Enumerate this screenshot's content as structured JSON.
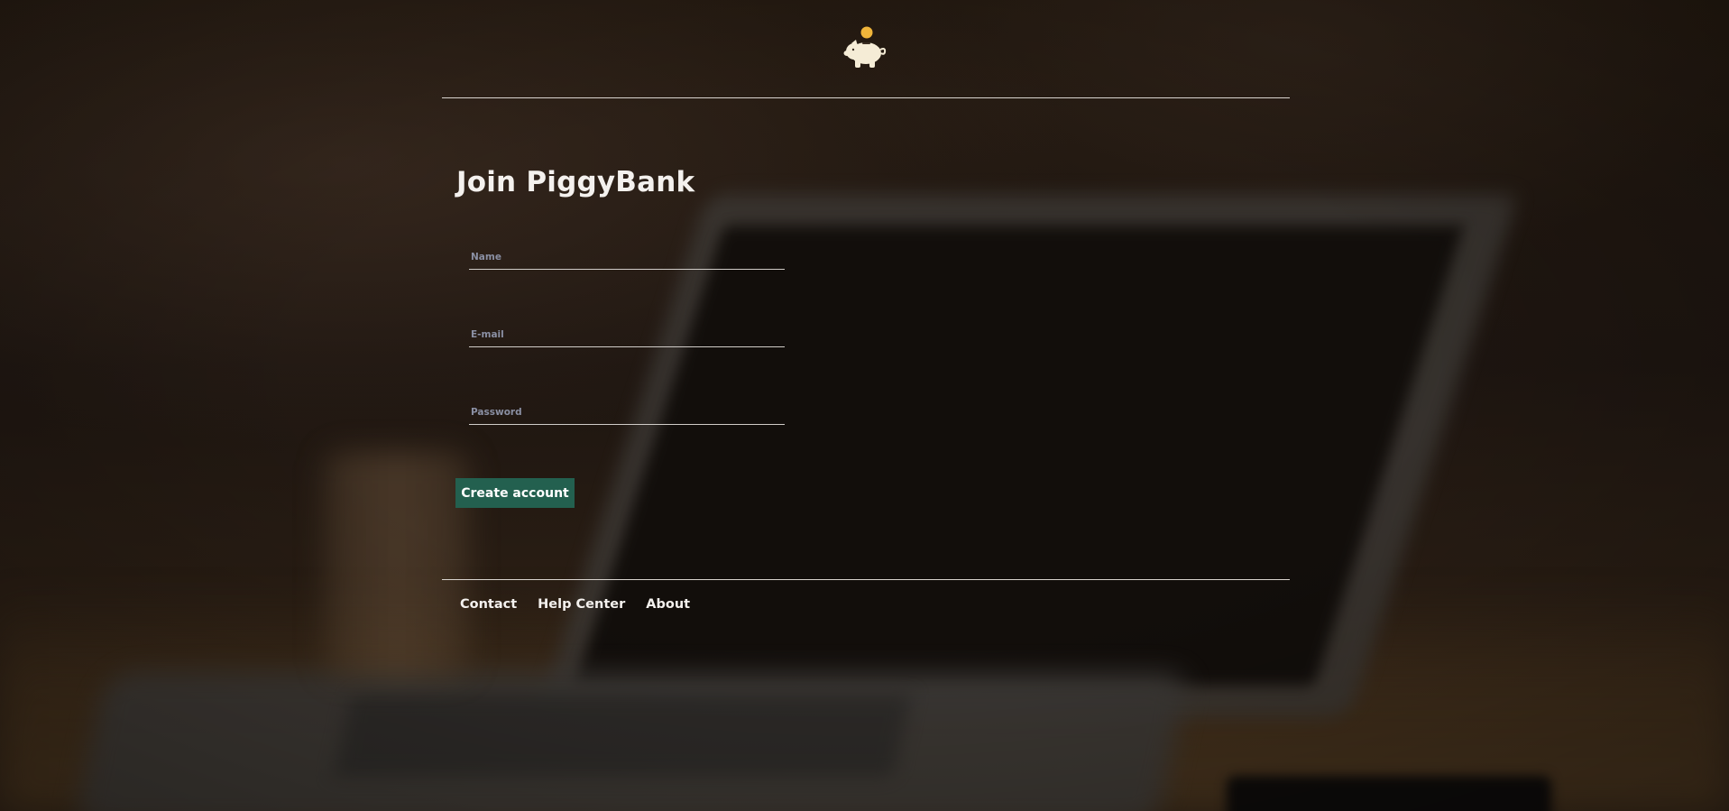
{
  "header": {
    "logo_icon": "piggy-bank-with-coin-icon"
  },
  "signup": {
    "title": "Join PiggyBank",
    "fields": {
      "name": {
        "placeholder": "Name",
        "value": ""
      },
      "email": {
        "placeholder": "E-mail",
        "value": ""
      },
      "password": {
        "placeholder": "Password",
        "value": ""
      }
    },
    "submit_label": "Create account"
  },
  "footer": {
    "links": [
      "Contact",
      "Help Center",
      "About"
    ]
  },
  "colors": {
    "accent_button": "#23604f",
    "coin": "#f0b53a",
    "pig": "#f5ecd6",
    "text": "#f4f1ee",
    "placeholder": "#8a8fa3"
  }
}
